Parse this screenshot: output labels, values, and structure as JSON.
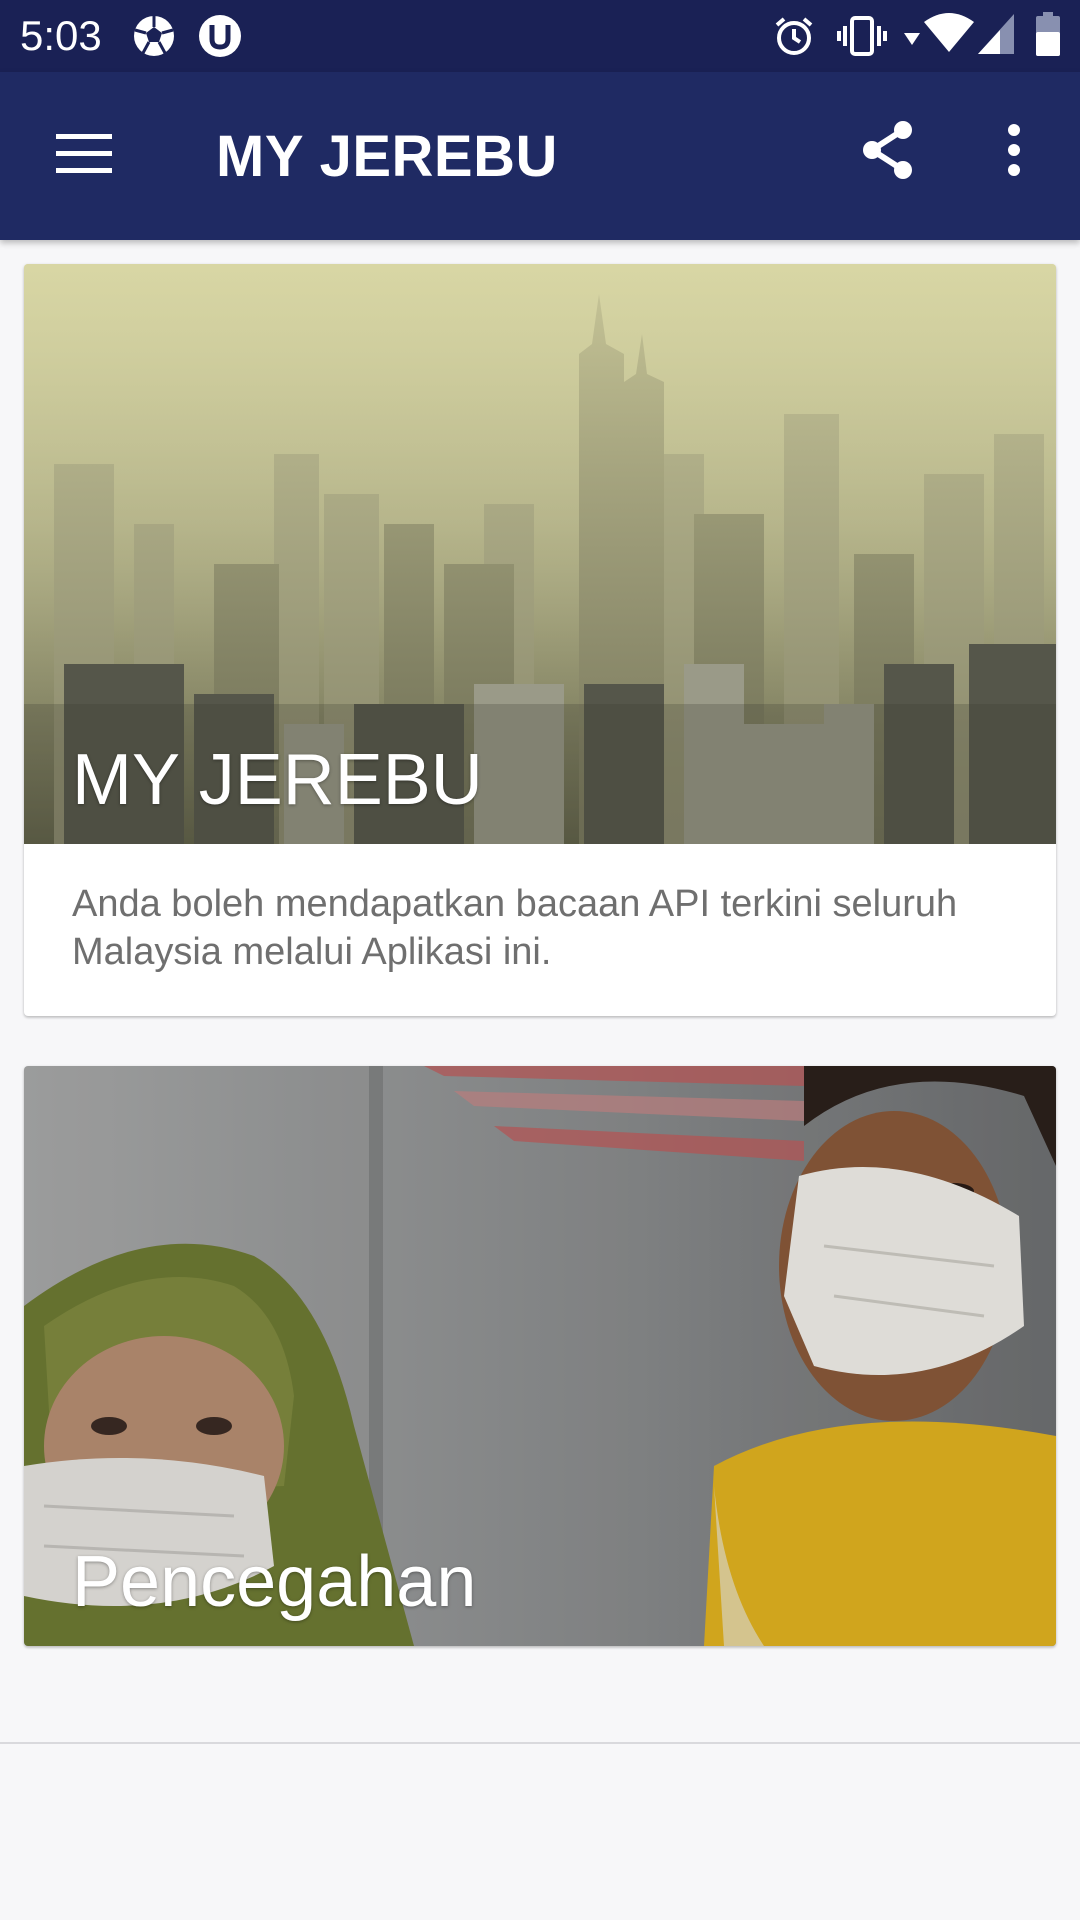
{
  "status_bar": {
    "time": "5:03",
    "icons": [
      "soccer-ball-icon",
      "u-notification-icon",
      "alarm-icon",
      "vibrate-icon",
      "wifi-icon",
      "signal-icon",
      "battery-icon"
    ]
  },
  "app_bar": {
    "title": "MY JEREBU",
    "icons": [
      "menu-icon",
      "share-icon",
      "overflow-menu-icon"
    ]
  },
  "cards": [
    {
      "title": "MY JEREBU",
      "description": "Anda boleh mendapatkan bacaan API terkini seluruh Malaysia melalui Aplikasi ini.",
      "image_subject": "hazy city skyline"
    },
    {
      "title": "Pencegahan",
      "image_subject": "people wearing face masks"
    }
  ],
  "colors": {
    "status_bar": "#1a2155",
    "app_bar": "#1f2a63",
    "background": "#f7f7f9",
    "card": "#ffffff",
    "description_text": "#6f6f6f"
  }
}
